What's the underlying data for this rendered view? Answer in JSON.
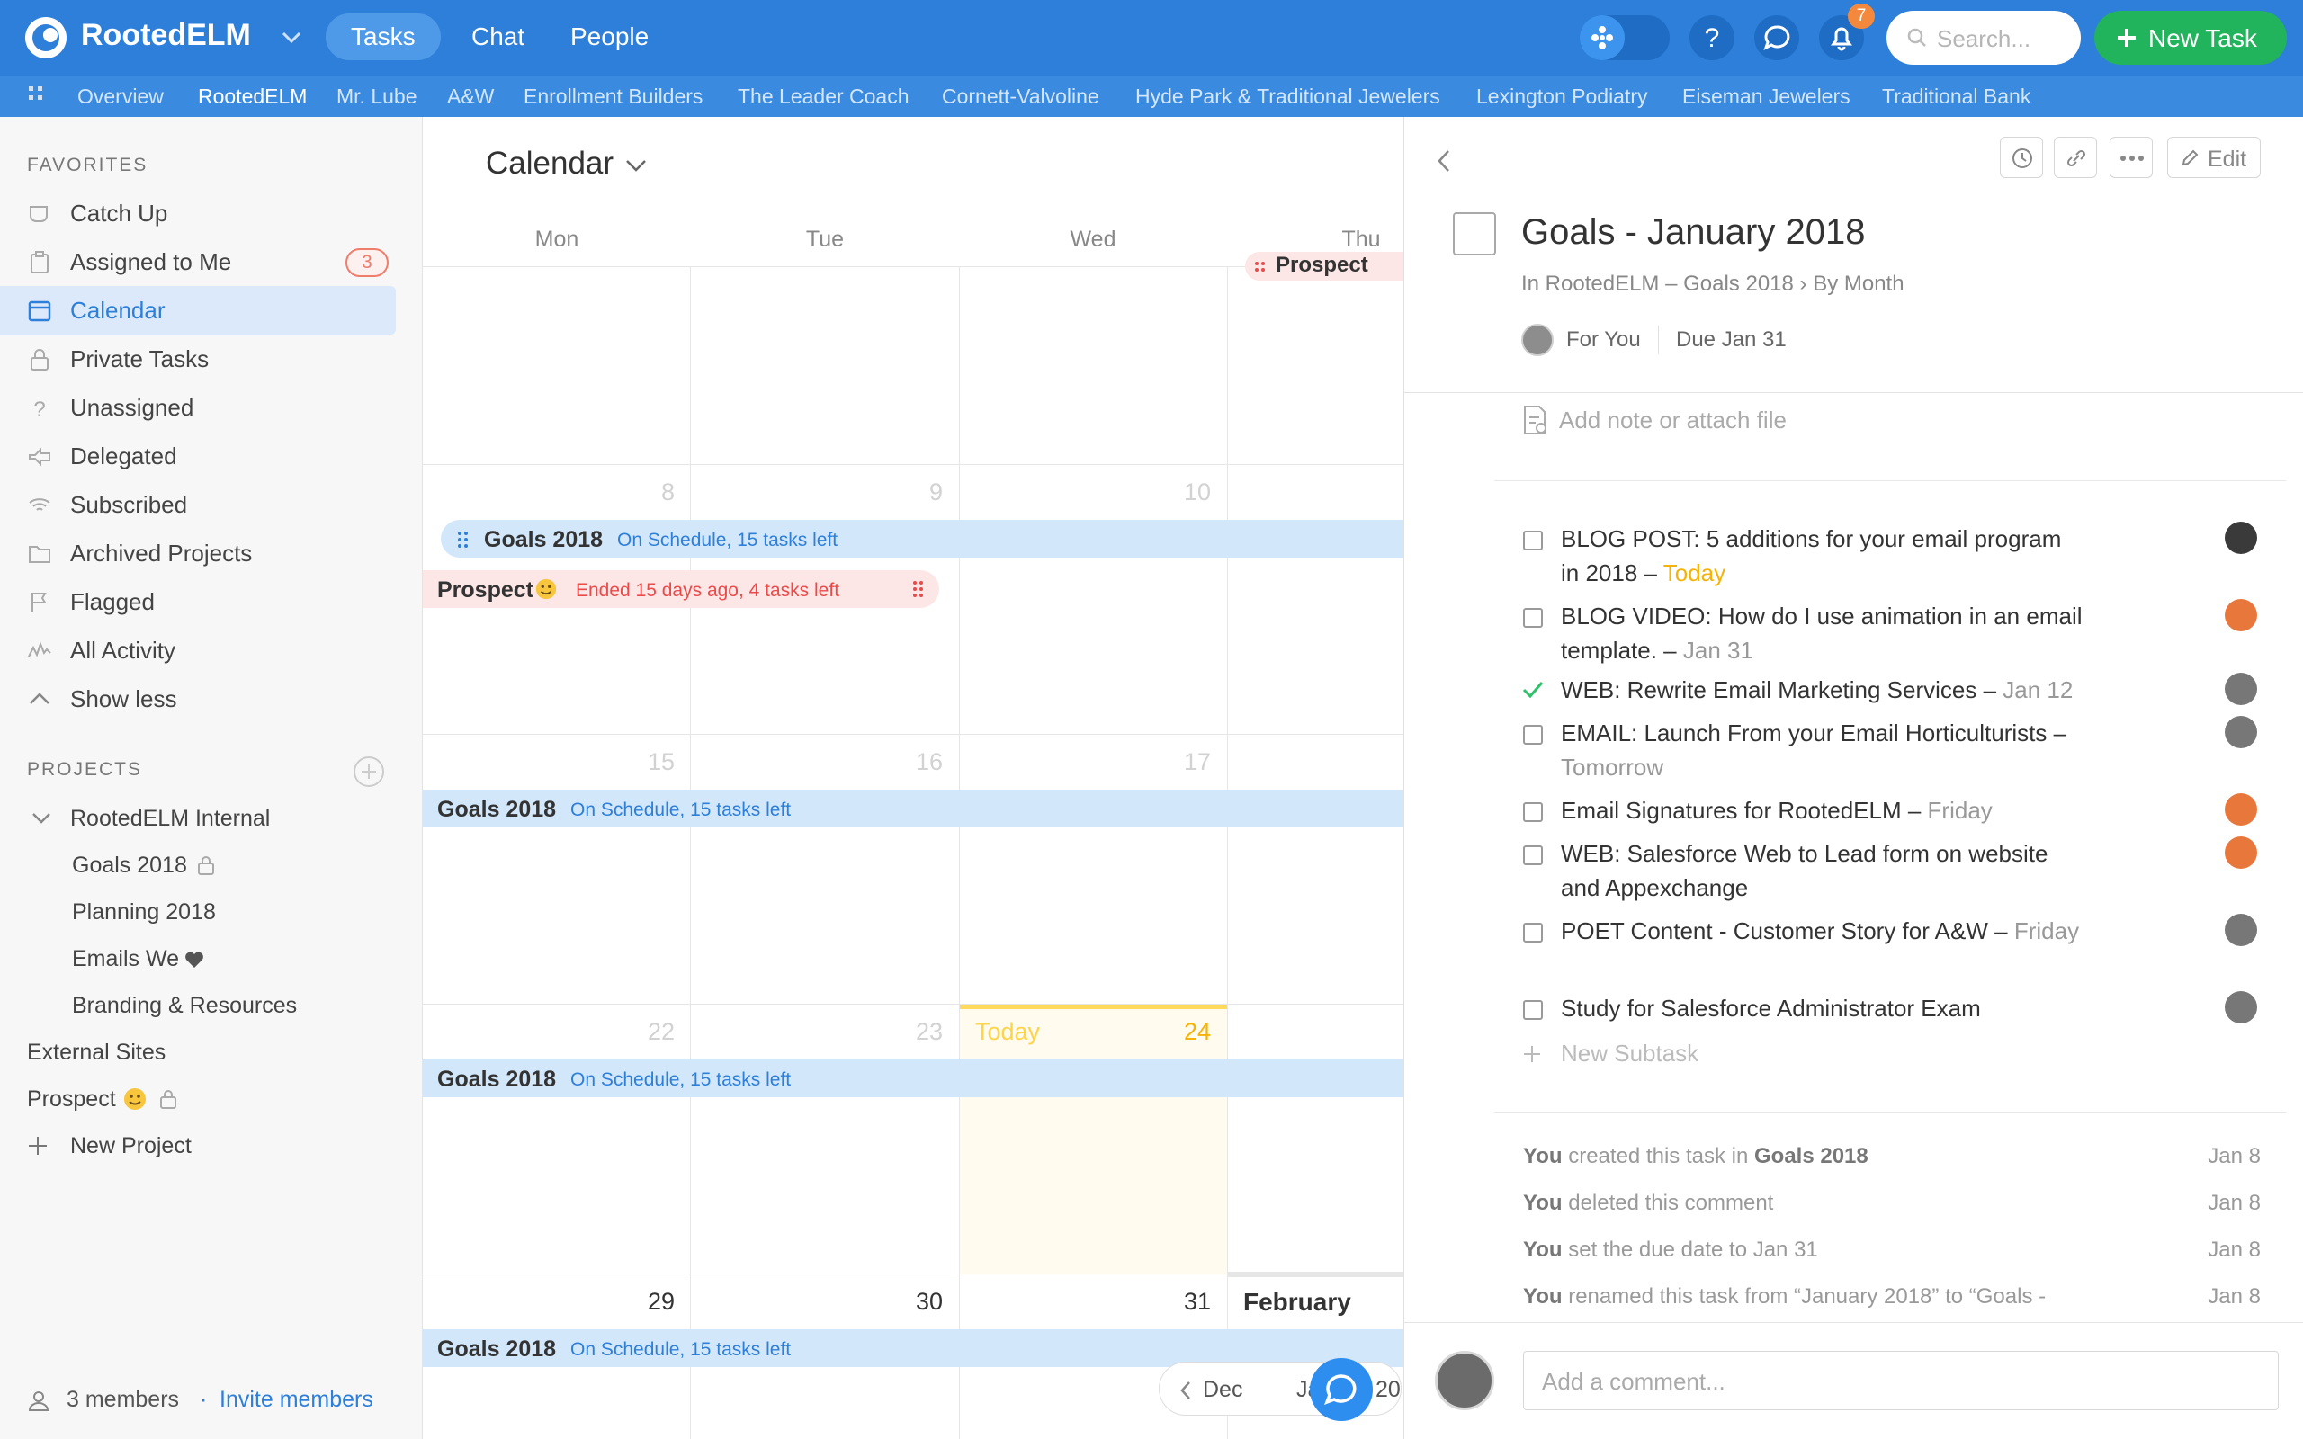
{
  "app": {
    "name": "RootedELM",
    "notifications": "7",
    "search_placeholder": "Search...",
    "new_task_label": "New Task"
  },
  "topnav": [
    {
      "label": "Tasks",
      "active": true
    },
    {
      "label": "Chat"
    },
    {
      "label": "People"
    }
  ],
  "subnav": [
    "Overview",
    "RootedELM",
    "Mr. Lube",
    "A&W",
    "Enrollment Builders",
    "The Leader Coach",
    "Cornett-Valvoline",
    "Hyde Park & Traditional Jewelers",
    "Lexington Podiatry",
    "Eiseman Jewelers",
    "Traditional Bank"
  ],
  "sidebar": {
    "favorites_heading": "FAVORITES",
    "favorites": [
      {
        "label": "Catch Up",
        "icon": "catch-up-icon"
      },
      {
        "label": "Assigned to Me",
        "icon": "clipboard-icon",
        "badge": "3"
      },
      {
        "label": "Calendar",
        "icon": "calendar-icon",
        "active": true
      },
      {
        "label": "Private Tasks",
        "icon": "lock-icon"
      },
      {
        "label": "Unassigned",
        "icon": "question-icon"
      },
      {
        "label": "Delegated",
        "icon": "delegate-icon"
      },
      {
        "label": "Subscribed",
        "icon": "wifi-icon"
      },
      {
        "label": "Archived Projects",
        "icon": "folder-icon"
      },
      {
        "label": "Flagged",
        "icon": "flag-icon"
      },
      {
        "label": "All Activity",
        "icon": "activity-icon"
      },
      {
        "label": "Show less",
        "icon": "chevron-up-icon"
      }
    ],
    "projects_heading": "PROJECTS",
    "projects": {
      "group": "RootedELM Internal",
      "children": [
        "Goals 2018",
        "Planning 2018",
        "Emails We",
        "Branding & Resources"
      ],
      "others": [
        "External Sites",
        "Prospect"
      ],
      "new_project": "New Project"
    },
    "footer": {
      "members": "3 members",
      "separator": "·",
      "invite": "Invite members"
    }
  },
  "calendar": {
    "title": "Calendar",
    "weekdays": [
      "Mon",
      "Tue",
      "Wed",
      "Thu"
    ],
    "weeks": [
      {
        "days": [
          "8",
          "9",
          "10",
          ""
        ]
      },
      {
        "days": [
          "15",
          "16",
          "17",
          ""
        ]
      },
      {
        "days": [
          "22",
          "23",
          "24",
          ""
        ],
        "today_label": "Today"
      },
      {
        "days": [
          "29",
          "30",
          "31",
          "February"
        ]
      }
    ],
    "events": {
      "goals_name": "Goals 2018",
      "goals_status": "On Schedule, 15 tasks left",
      "prospect_name": "Prospect",
      "prospect_status": "Ended 15 days ago, 4 tasks left"
    },
    "nav": {
      "prev": "Dec",
      "current": "Ja",
      "next_partial": "20"
    }
  },
  "detail": {
    "buttons": {
      "edit": "Edit"
    },
    "title": "Goals - January 2018",
    "path": "In RootedELM – Goals 2018 › By Month",
    "assignee": "For You",
    "due": "Due Jan 31",
    "note_placeholder": "Add note or attach file",
    "subtasks": [
      {
        "text": "BLOG POST: 5 additions for your email program in 2018",
        "due": "Today",
        "due_today": true,
        "done": false
      },
      {
        "text": "BLOG VIDEO: How do I use animation in an email template.",
        "due": "Jan 31",
        "done": false
      },
      {
        "text": "WEB: Rewrite Email Marketing Services",
        "due": "Jan 12",
        "done": true
      },
      {
        "text": "EMAIL: Launch From your Email Horticulturists",
        "due": "Tomorrow",
        "done": false
      },
      {
        "text": "Email Signatures for RootedELM",
        "due": "Friday",
        "done": false
      },
      {
        "text": "WEB: Salesforce Web to Lead form on website and Appexchange",
        "due": "",
        "done": false
      },
      {
        "text": "POET Content - Customer Story for A&W",
        "due": "Friday",
        "done": false
      },
      {
        "text": "Study for Salesforce Administrator Exam",
        "due": "",
        "done": false
      }
    ],
    "new_subtask": "New Subtask",
    "activity": [
      {
        "actor": "You",
        "text": " created this task in ",
        "target": "Goals 2018",
        "date": "Jan 8"
      },
      {
        "actor": "You",
        "text": " deleted this comment",
        "target": "",
        "date": "Jan 8"
      },
      {
        "actor": "You",
        "text": " set the due date to Jan 31",
        "target": "",
        "date": "Jan 8"
      },
      {
        "actor": "You",
        "text": " renamed this task from “January 2018” to “Goals -",
        "target": "",
        "date": "Jan 8"
      }
    ],
    "comment_placeholder": "Add a comment..."
  },
  "colors": {
    "brand": "#2d7fd9",
    "success": "#22b45c",
    "danger": "#e94b4b",
    "today": "#f5b30a"
  }
}
